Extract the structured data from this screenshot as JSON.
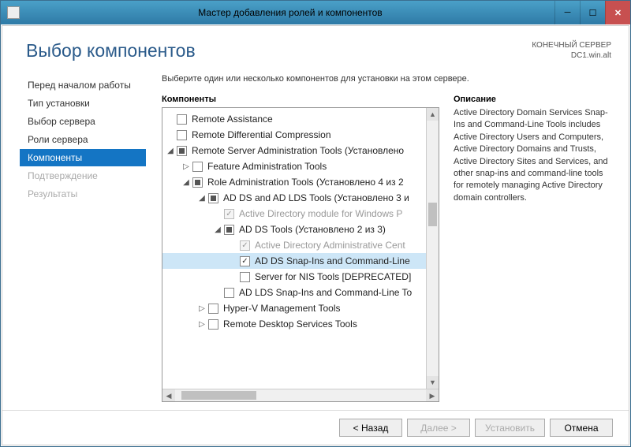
{
  "window": {
    "title": "Мастер добавления ролей и компонентов"
  },
  "header": {
    "page_title": "Выбор компонентов",
    "server_label": "КОНЕЧНЫЙ СЕРВЕР",
    "server_name": "DC1.win.alt"
  },
  "nav": {
    "items": [
      {
        "label": "Перед началом работы",
        "state": "normal"
      },
      {
        "label": "Тип установки",
        "state": "normal"
      },
      {
        "label": "Выбор сервера",
        "state": "normal"
      },
      {
        "label": "Роли сервера",
        "state": "normal"
      },
      {
        "label": "Компоненты",
        "state": "selected"
      },
      {
        "label": "Подтверждение",
        "state": "disabled"
      },
      {
        "label": "Результаты",
        "state": "disabled"
      }
    ]
  },
  "main": {
    "instruction": "Выберите один или несколько компонентов для установки на этом сервере.",
    "components_title": "Компоненты",
    "description_title": "Описание",
    "description_text": "Active Directory Domain Services Snap-Ins and Command-Line Tools includes Active Directory Users and Computers, Active Directory Domains and Trusts, Active Directory Sites and Services, and other snap-ins and command-line tools for remotely managing Active Directory domain controllers."
  },
  "tree": [
    {
      "indent": 0,
      "toggle": "none",
      "check": "unchecked",
      "label": "Remote Assistance",
      "disabled": false
    },
    {
      "indent": 0,
      "toggle": "none",
      "check": "unchecked",
      "label": "Remote Differential Compression",
      "disabled": false
    },
    {
      "indent": 0,
      "toggle": "expanded",
      "check": "partial",
      "label": "Remote Server Administration Tools (Установлено",
      "disabled": false
    },
    {
      "indent": 1,
      "toggle": "collapsed",
      "check": "unchecked",
      "label": "Feature Administration Tools",
      "disabled": false
    },
    {
      "indent": 1,
      "toggle": "expanded",
      "check": "partial",
      "label": "Role Administration Tools (Установлено 4 из 2",
      "disabled": false
    },
    {
      "indent": 2,
      "toggle": "expanded",
      "check": "partial",
      "label": "AD DS and AD LDS Tools (Установлено 3 и",
      "disabled": false
    },
    {
      "indent": 3,
      "toggle": "none",
      "check": "checked",
      "label": "Active Directory module for Windows P",
      "disabled": true
    },
    {
      "indent": 3,
      "toggle": "expanded",
      "check": "partial",
      "label": "AD DS Tools (Установлено 2 из 3)",
      "disabled": false
    },
    {
      "indent": 4,
      "toggle": "none",
      "check": "checked",
      "label": "Active Directory Administrative Cent",
      "disabled": true
    },
    {
      "indent": 4,
      "toggle": "none",
      "check": "checked",
      "label": "AD DS Snap-Ins and Command-Line",
      "disabled": false,
      "selected": true
    },
    {
      "indent": 4,
      "toggle": "none",
      "check": "unchecked",
      "label": "Server for NIS Tools [DEPRECATED]",
      "disabled": false
    },
    {
      "indent": 3,
      "toggle": "none",
      "check": "unchecked",
      "label": "AD LDS Snap-Ins and Command-Line To",
      "disabled": false
    },
    {
      "indent": 2,
      "toggle": "collapsed",
      "check": "unchecked",
      "label": "Hyper-V Management Tools",
      "disabled": false
    },
    {
      "indent": 2,
      "toggle": "collapsed",
      "check": "unchecked",
      "label": "Remote Desktop Services Tools",
      "disabled": false
    }
  ],
  "footer": {
    "back": "< Назад",
    "next": "Далее >",
    "install": "Установить",
    "cancel": "Отмена"
  }
}
